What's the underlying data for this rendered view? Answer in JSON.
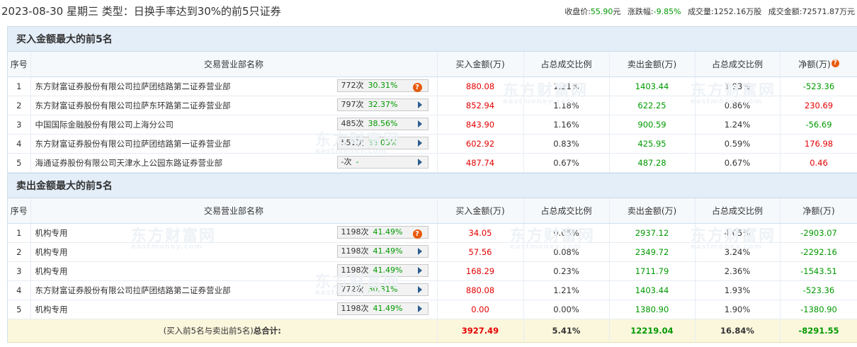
{
  "header": {
    "title": "2023-08-30 星期三 类型：日换手率达到30%的前5只证券",
    "close_label": "收盘价:",
    "close_value": "55.90",
    "close_unit": "元",
    "change_label": "涨跌幅:",
    "change_value": "-9.85%",
    "volume_label": "成交量:",
    "volume_value": "1252.16万股",
    "amount_label": "成交金额:",
    "amount_value": "72571.87万元"
  },
  "columns": {
    "seq": "序号",
    "name": "交易营业部名称",
    "buy": "买入金额(万)",
    "buy_ratio": "占总成交比例",
    "sell": "卖出金额(万)",
    "sell_ratio": "占总成交比例",
    "net": "净额(万)"
  },
  "buy_section": {
    "title": "买入金额最大的前5名",
    "rows": [
      {
        "seq": "1",
        "name": "东方财富证券股份有限公司拉萨团结路第二证券营业部",
        "count": "772次",
        "pct": "30.31%",
        "action": "question",
        "buy": "880.08",
        "buy_ratio": "1.21%",
        "sell": "1403.44",
        "sell_ratio": "1.93%",
        "net": "-523.36",
        "net_color": "green"
      },
      {
        "seq": "2",
        "name": "东方财富证券股份有限公司拉萨东环路第二证券营业部",
        "count": "797次",
        "pct": "32.37%",
        "action": "arrow",
        "buy": "852.94",
        "buy_ratio": "1.18%",
        "sell": "622.25",
        "sell_ratio": "0.86%",
        "net": "230.69",
        "net_color": "red"
      },
      {
        "seq": "3",
        "name": "中国国际金融股份有限公司上海分公司",
        "count": "485次",
        "pct": "38.56%",
        "action": "arrow",
        "buy": "843.90",
        "buy_ratio": "1.16%",
        "sell": "900.59",
        "sell_ratio": "1.24%",
        "net": "-56.69",
        "net_color": "green"
      },
      {
        "seq": "4",
        "name": "东方财富证券股份有限公司拉萨团结路第一证券营业部",
        "count": "551次",
        "pct": "35.03%",
        "action": "arrow",
        "buy": "602.92",
        "buy_ratio": "0.83%",
        "sell": "425.95",
        "sell_ratio": "0.59%",
        "net": "176.98",
        "net_color": "red"
      },
      {
        "seq": "5",
        "name": "海通证券股份有限公司天津水上公园东路证券营业部",
        "count": "-次",
        "pct": "-",
        "action": "arrow",
        "buy": "487.74",
        "buy_ratio": "0.67%",
        "sell": "487.28",
        "sell_ratio": "0.67%",
        "net": "0.46",
        "net_color": "red"
      }
    ]
  },
  "sell_section": {
    "title": "卖出金额最大的前5名",
    "rows": [
      {
        "seq": "1",
        "name": "机构专用",
        "count": "1198次",
        "pct": "41.49%",
        "action": "question",
        "buy": "34.05",
        "buy_ratio": "0.05%",
        "sell": "2937.12",
        "sell_ratio": "4.05%",
        "net": "-2903.07",
        "net_color": "green"
      },
      {
        "seq": "2",
        "name": "机构专用",
        "count": "1198次",
        "pct": "41.49%",
        "action": "arrow",
        "buy": "57.56",
        "buy_ratio": "0.08%",
        "sell": "2349.72",
        "sell_ratio": "3.24%",
        "net": "-2292.16",
        "net_color": "green"
      },
      {
        "seq": "3",
        "name": "机构专用",
        "count": "1198次",
        "pct": "41.49%",
        "action": "arrow",
        "buy": "168.29",
        "buy_ratio": "0.23%",
        "sell": "1711.79",
        "sell_ratio": "2.36%",
        "net": "-1543.51",
        "net_color": "green"
      },
      {
        "seq": "4",
        "name": "东方财富证券股份有限公司拉萨团结路第二证券营业部",
        "count": "772次",
        "pct": "30.31%",
        "action": "arrow",
        "buy": "880.08",
        "buy_ratio": "1.21%",
        "sell": "1403.44",
        "sell_ratio": "1.93%",
        "net": "-523.36",
        "net_color": "green"
      },
      {
        "seq": "5",
        "name": "机构专用",
        "count": "1198次",
        "pct": "41.49%",
        "action": "arrow",
        "buy": "0.00",
        "buy_ratio": "0.00%",
        "sell": "1380.90",
        "sell_ratio": "1.90%",
        "net": "-1380.90",
        "net_color": "green"
      }
    ]
  },
  "total": {
    "label_prefix": "(买入前5名与卖出前5名)",
    "label_bold": "总合计:",
    "buy": "3927.49",
    "buy_ratio": "5.41%",
    "sell": "12219.04",
    "sell_ratio": "16.84%",
    "net": "-8291.55"
  },
  "watermark": {
    "cn": "东方财富网",
    "en": "eastmoney.com"
  },
  "colors": {
    "red": "#e40000",
    "green": "#009900",
    "header_bg": "#e4eef8",
    "total_bg": "#fbf7dd",
    "icon_orange": "#e85a0c"
  }
}
